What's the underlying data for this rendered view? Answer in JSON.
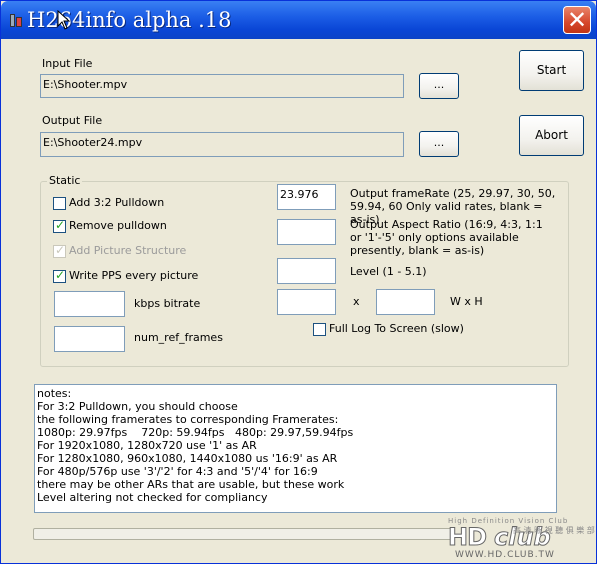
{
  "window": {
    "title": "H264info alpha .18",
    "close_glyph": "✕"
  },
  "input_file": {
    "label": "Input File",
    "value": "E:\\Shooter.mpv",
    "browse_label": "..."
  },
  "output_file": {
    "label": "Output File",
    "value": "E:\\Shooter24.mpv",
    "browse_label": "..."
  },
  "actions": {
    "start_label": "Start",
    "abort_label": "Abort"
  },
  "static_group": {
    "title": "Static",
    "checkboxes": [
      {
        "label": "Add 3:2 Pulldown",
        "checked": false,
        "enabled": true
      },
      {
        "label": "Remove pulldown",
        "checked": true,
        "enabled": true
      },
      {
        "label": "Add Picture Structure",
        "checked": true,
        "enabled": false
      },
      {
        "label": "Write PPS every picture",
        "checked": true,
        "enabled": true
      }
    ],
    "bitrate": {
      "value": "",
      "label": "kbps bitrate"
    },
    "num_ref_frames": {
      "value": "",
      "label": "num_ref_frames"
    },
    "frame_rate": {
      "value": "23.976",
      "label": "Output frameRate (25, 29.97, 30, 50, 59.94, 60 Only valid rates, blank = as-is)"
    },
    "aspect_ratio": {
      "value": "",
      "label": "Output Aspect Ratio (16:9, 4:3, 1:1 or '1'-'5' only options available presently, blank = as-is)"
    },
    "level": {
      "value": "",
      "label": "Level (1 - 5.1)"
    },
    "size": {
      "width": "",
      "separator": "x",
      "height": "",
      "label": "W x H"
    },
    "full_log": {
      "label": "Full Log To Screen (slow)",
      "checked": false
    }
  },
  "notes": [
    "notes:",
    "For 3:2 Pulldown, you should choose",
    "the following framerates to corresponding Framerates:",
    "1080p: 29.97fps    720p: 59.94fps   480p: 29.97,59.94fps",
    "For 1920x1080, 1280x720 use '1' as AR",
    "For 1280x1080, 960x1080, 1440x1080 us '16:9' as AR",
    "For 480p/576p use '3'/'2' for 4:3 and '5'/'4' for 16:9",
    "there may be other ARs that are usable, but these work",
    "Level altering not checked for compliancy"
  ],
  "progress": {
    "value_percent": 0
  },
  "watermark": {
    "tagline": "High Definition Vision Club",
    "hd": "HD",
    "club": "club",
    "cjk": "高 清 晰 視 聽 俱 樂 部",
    "url": "WWW.HD.CLUB.TW"
  }
}
